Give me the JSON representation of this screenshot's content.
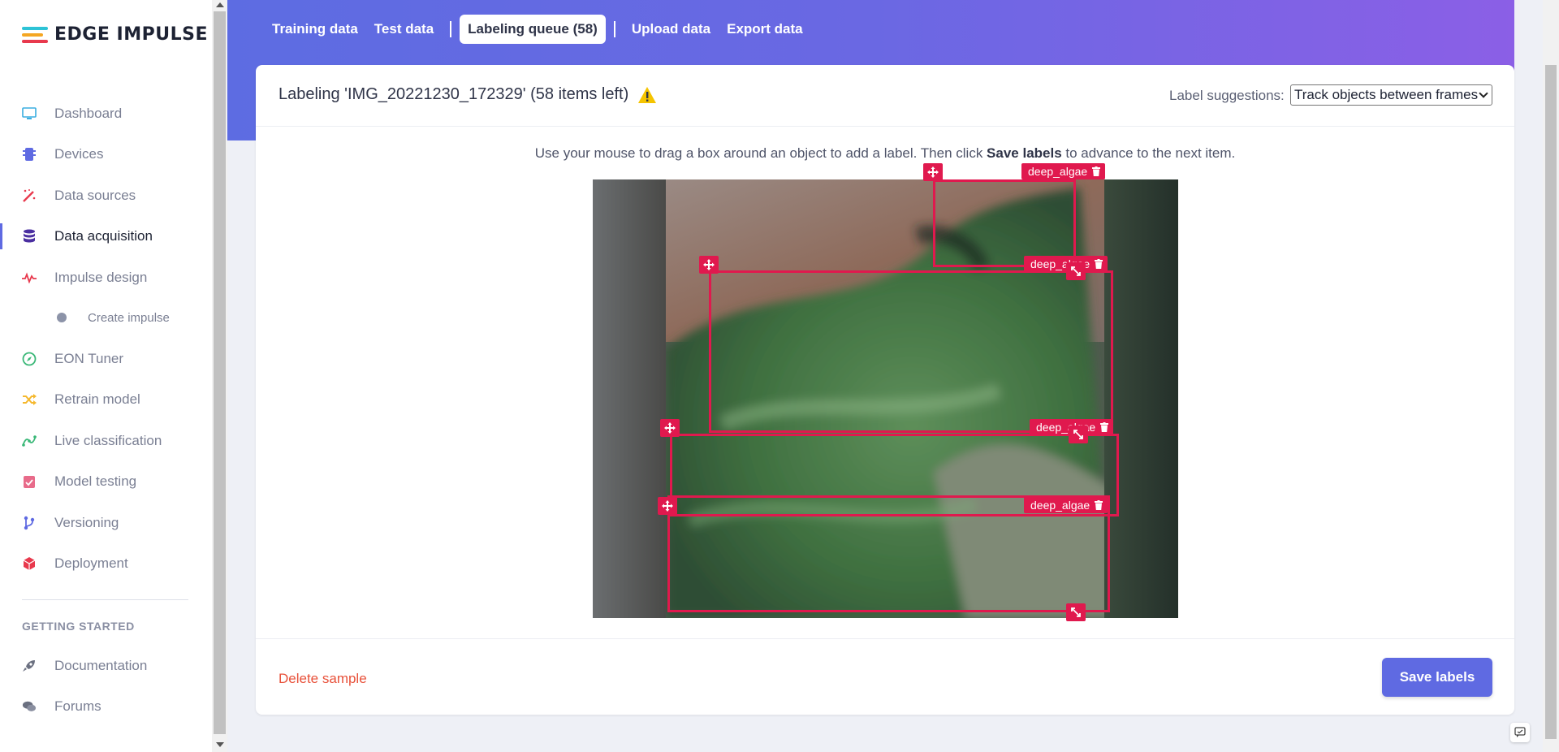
{
  "brand": {
    "name": "EDGE IMPULSE",
    "logo_colors": [
      "#2dc3d6",
      "#f5a623",
      "#e8394d"
    ]
  },
  "sidebar": {
    "items": [
      {
        "label": "Dashboard",
        "icon": "monitor-icon",
        "color": "#3aaee0"
      },
      {
        "label": "Devices",
        "icon": "chip-icon",
        "color": "#5f6ae2"
      },
      {
        "label": "Data sources",
        "icon": "magic-wand-icon",
        "color": "#e8394d"
      },
      {
        "label": "Data acquisition",
        "icon": "database-icon",
        "color": "#4a2ea0"
      },
      {
        "label": "Impulse design",
        "icon": "pulse-icon",
        "color": "#e8394d"
      },
      {
        "label": "Create impulse",
        "icon": "dot-icon",
        "color": "#8c93a8"
      },
      {
        "label": "EON Tuner",
        "icon": "compass-icon",
        "color": "#3bb878"
      },
      {
        "label": "Retrain model",
        "icon": "shuffle-icon",
        "color": "#f5b82e"
      },
      {
        "label": "Live classification",
        "icon": "graph-icon",
        "color": "#3bb878"
      },
      {
        "label": "Model testing",
        "icon": "clipboard-check-icon",
        "color": "#e86b8a"
      },
      {
        "label": "Versioning",
        "icon": "branch-icon",
        "color": "#5f6ae2"
      },
      {
        "label": "Deployment",
        "icon": "cube-icon",
        "color": "#e8394d"
      }
    ],
    "section_title": "GETTING STARTED",
    "getting_started": [
      {
        "label": "Documentation",
        "icon": "rocket-icon",
        "color": "#6b7080"
      },
      {
        "label": "Forums",
        "icon": "chat-icon",
        "color": "#6b7080"
      }
    ]
  },
  "tabs": [
    {
      "label": "Training data"
    },
    {
      "label": "Test data"
    },
    {
      "label": "Labeling queue (58)"
    },
    {
      "label": "Upload data"
    },
    {
      "label": "Export data"
    }
  ],
  "card": {
    "title": "Labeling 'IMG_20221230_172329' (58 items left)",
    "label_suggestions_label": "Label suggestions:",
    "label_suggestions_value": "Track objects between frames",
    "instruction_pre": "Use your mouse to drag a box around an object to add a label. Then click ",
    "instruction_bold": "Save labels",
    "instruction_post": " to advance to the next item.",
    "boxes": [
      {
        "label": "deep_algae"
      },
      {
        "label": "deep_algae"
      },
      {
        "label": "deep_algae"
      },
      {
        "label": "deep_algae"
      }
    ],
    "delete_label": "Delete sample",
    "save_label": "Save labels"
  },
  "colors": {
    "accent": "#5f6ae2",
    "box": "#e0194e",
    "danger": "#e8513a",
    "warning": "#f5c400"
  }
}
